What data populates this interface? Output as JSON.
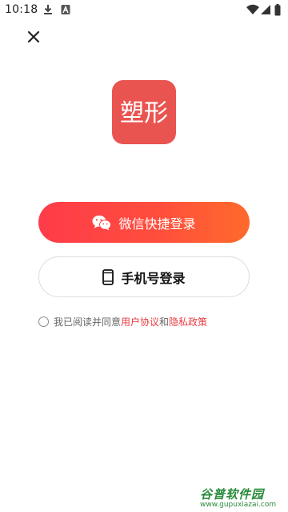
{
  "status_bar": {
    "time": "10:18",
    "icons": [
      "download-icon",
      "notification-icon",
      "wifi-icon",
      "signal-icon",
      "battery-icon"
    ]
  },
  "header": {
    "close_icon": "close-icon"
  },
  "logo": {
    "text": "塑形",
    "color": "#ea5450"
  },
  "buttons": {
    "wechat_label": "微信快捷登录",
    "wechat_icon": "wechat-icon",
    "phone_label": "手机号登录",
    "phone_icon": "phone-icon"
  },
  "agreement": {
    "prefix": "我已阅读并同意",
    "user_agreement": "用户协议",
    "conjunction": "和",
    "privacy_policy": "隐私政策",
    "link_color": "#e83b40"
  },
  "watermark": {
    "title": "谷普软件园",
    "url": "www.gupuxiazai.com"
  },
  "colors": {
    "accent_start": "#ff3b4a",
    "accent_end": "#ff6a2c"
  }
}
